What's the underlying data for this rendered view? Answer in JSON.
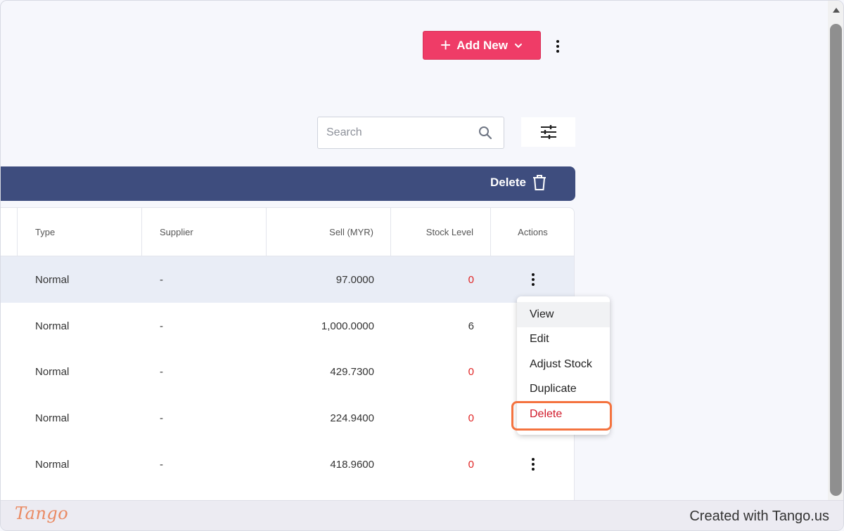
{
  "toolbar": {
    "add_new_label": "Add New"
  },
  "search": {
    "placeholder": "Search"
  },
  "bulk_bar": {
    "delete_label": "Delete"
  },
  "table": {
    "columns": [
      "Type",
      "Supplier",
      "Sell (MYR)",
      "Stock Level",
      "Actions"
    ],
    "rows": [
      {
        "type": "Normal",
        "supplier": "-",
        "sell": "97.0000",
        "stock": "0"
      },
      {
        "type": "Normal",
        "supplier": "-",
        "sell": "1,000.0000",
        "stock": "6"
      },
      {
        "type": "Normal",
        "supplier": "-",
        "sell": "429.7300",
        "stock": "0"
      },
      {
        "type": "Normal",
        "supplier": "-",
        "sell": "224.9400",
        "stock": "0"
      },
      {
        "type": "Normal",
        "supplier": "-",
        "sell": "418.9600",
        "stock": "0"
      }
    ]
  },
  "actions_menu": {
    "items": [
      "View",
      "Edit",
      "Adjust Stock",
      "Duplicate",
      "Delete"
    ]
  },
  "footer": {
    "logo_text": "Tango",
    "credit": "Created with Tango.us"
  },
  "colors": {
    "accent": "#ef3c67",
    "bulk_bar": "#3e4d7e",
    "zero_stock": "#e02424",
    "highlight": "#f4733f"
  }
}
